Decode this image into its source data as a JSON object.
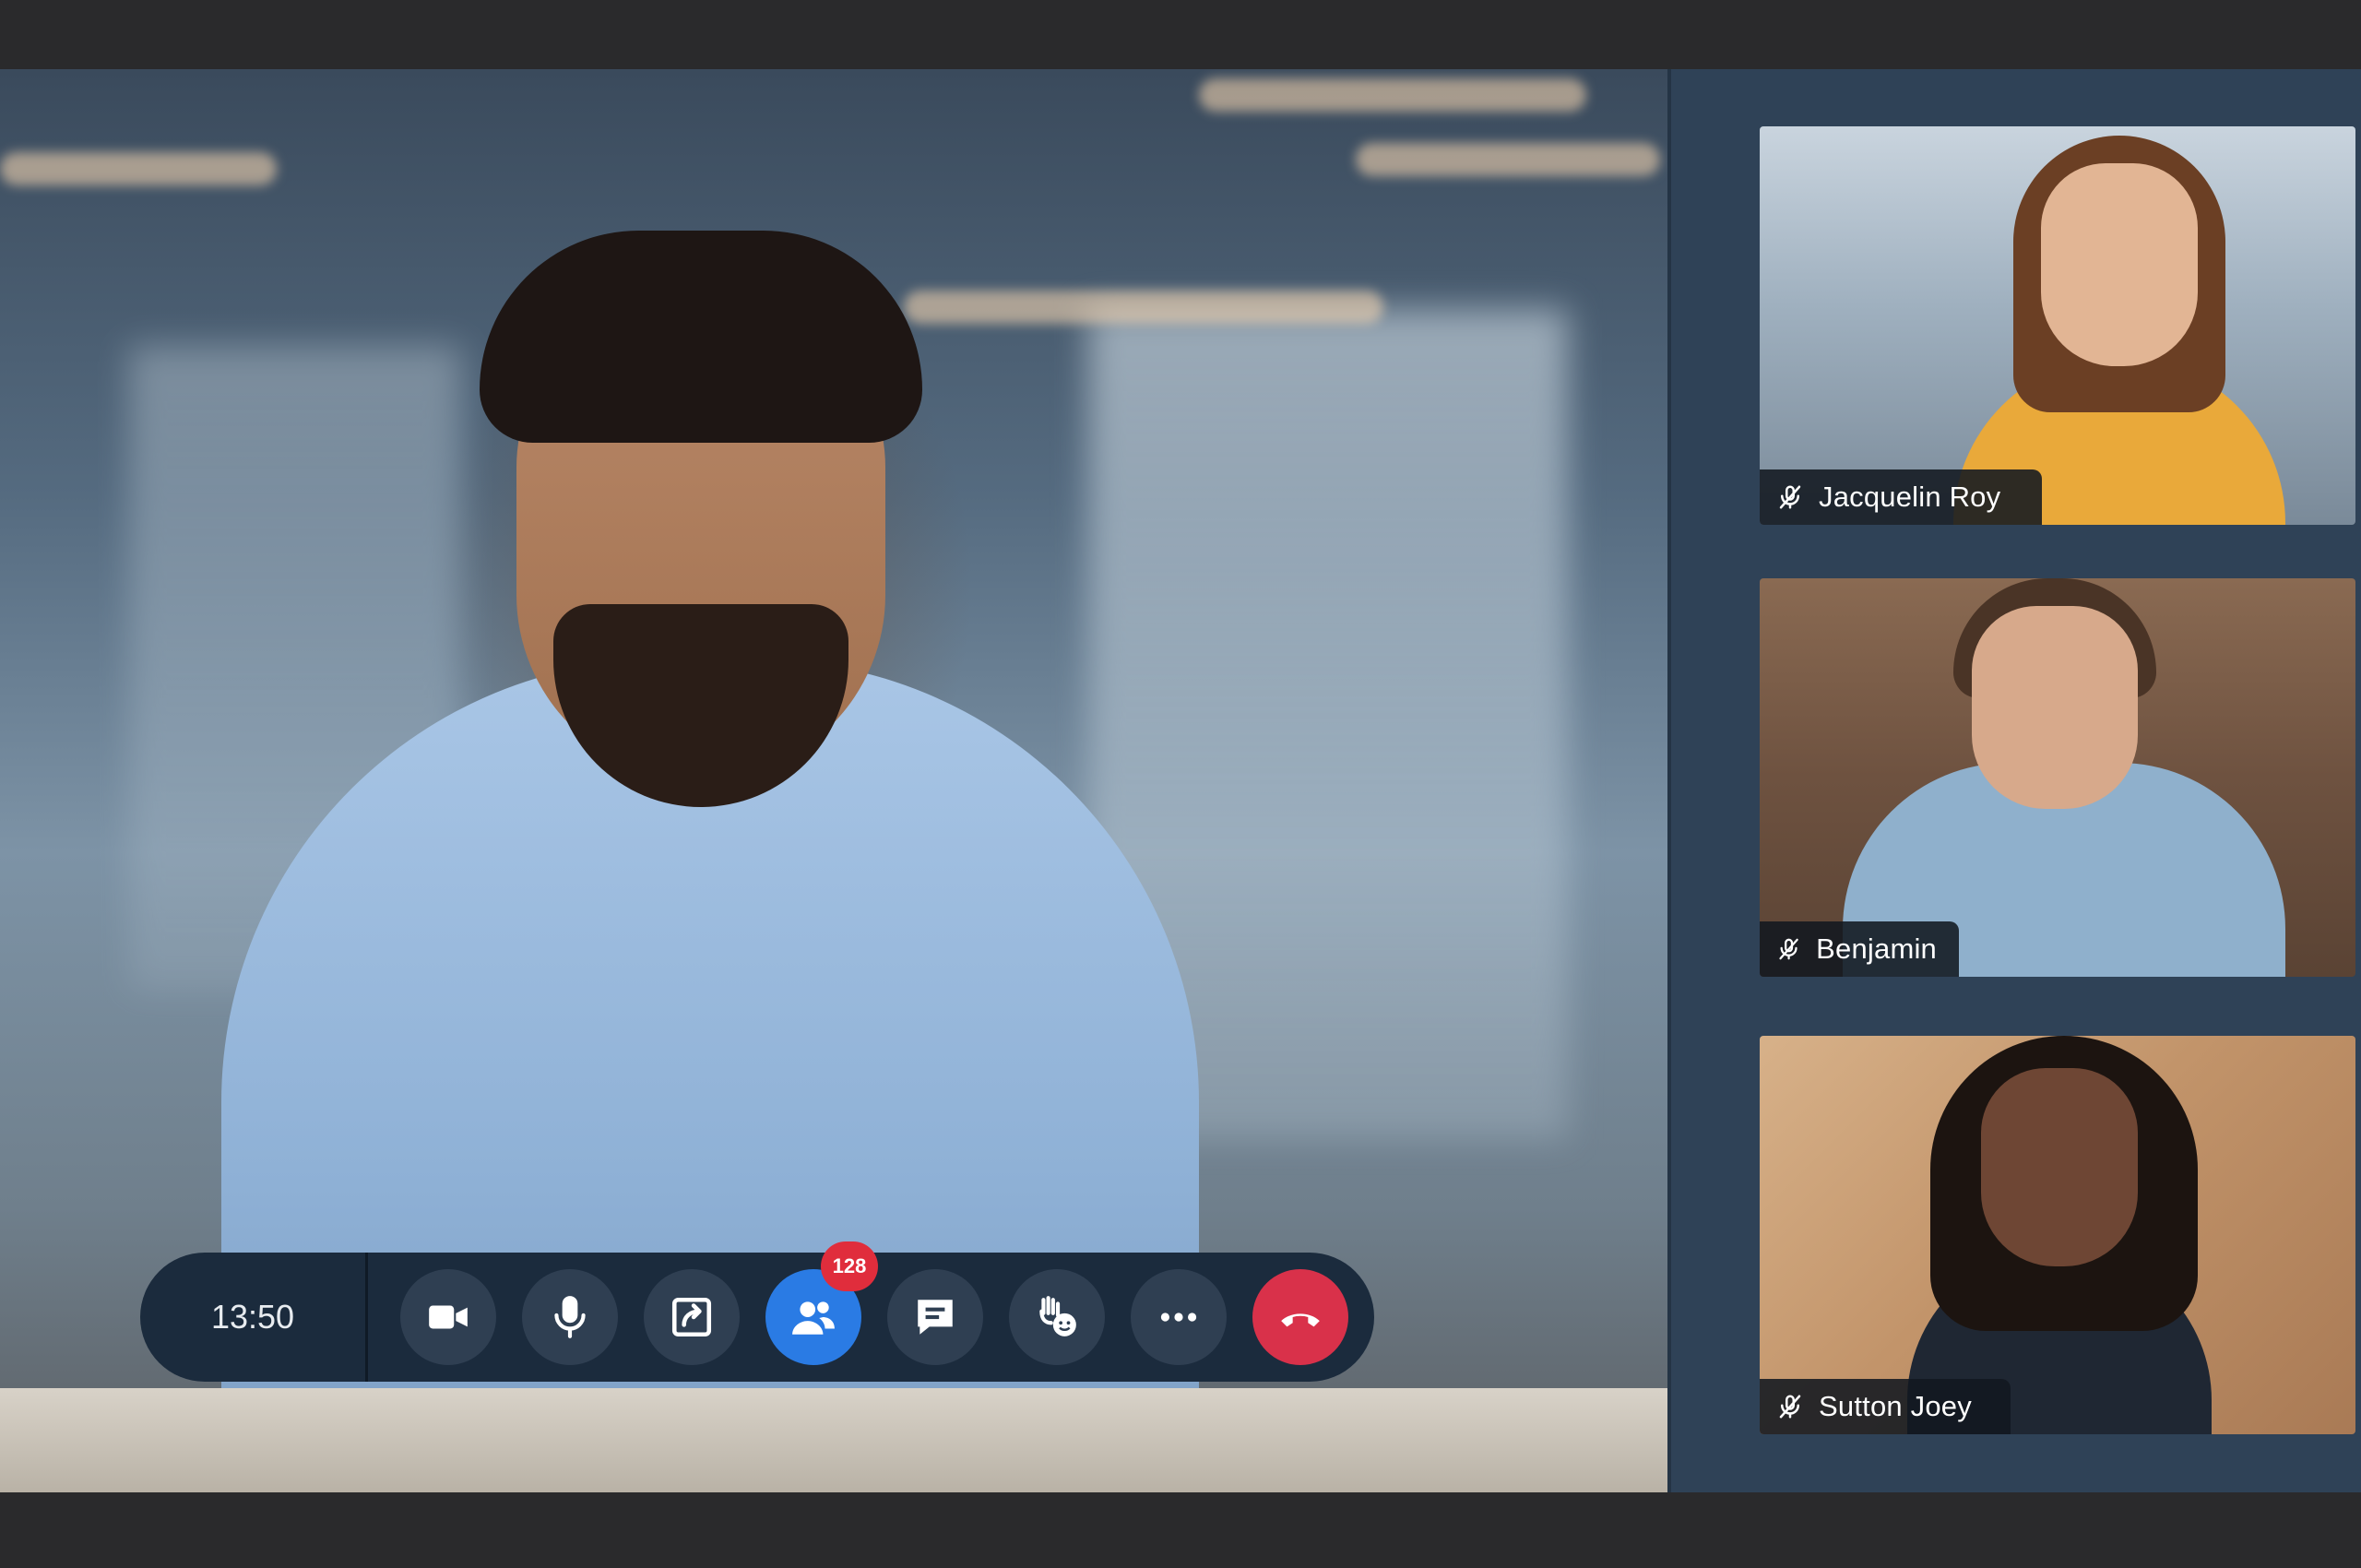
{
  "call": {
    "timer": "13:50",
    "participants_count": "128"
  },
  "controls": [
    {
      "id": "camera",
      "icon": "video-camera-icon"
    },
    {
      "id": "microphone",
      "icon": "microphone-icon"
    },
    {
      "id": "share",
      "icon": "share-screen-icon"
    },
    {
      "id": "participants",
      "icon": "participants-icon",
      "active": true
    },
    {
      "id": "chat",
      "icon": "chat-icon"
    },
    {
      "id": "reactions",
      "icon": "raise-hand-icon"
    },
    {
      "id": "more",
      "icon": "more-icon"
    },
    {
      "id": "hangup",
      "icon": "hang-up-icon"
    }
  ],
  "participants": [
    {
      "name": "Jacquelin Roy",
      "muted": true
    },
    {
      "name": "Benjamin",
      "muted": true
    },
    {
      "name": "Sutton Joey",
      "muted": true
    }
  ],
  "colors": {
    "panel": "#2f4257",
    "control_bar": "#1b2b3d",
    "active": "#2a7be4",
    "hangup": "#d9314a",
    "badge": "#e02d3c"
  }
}
